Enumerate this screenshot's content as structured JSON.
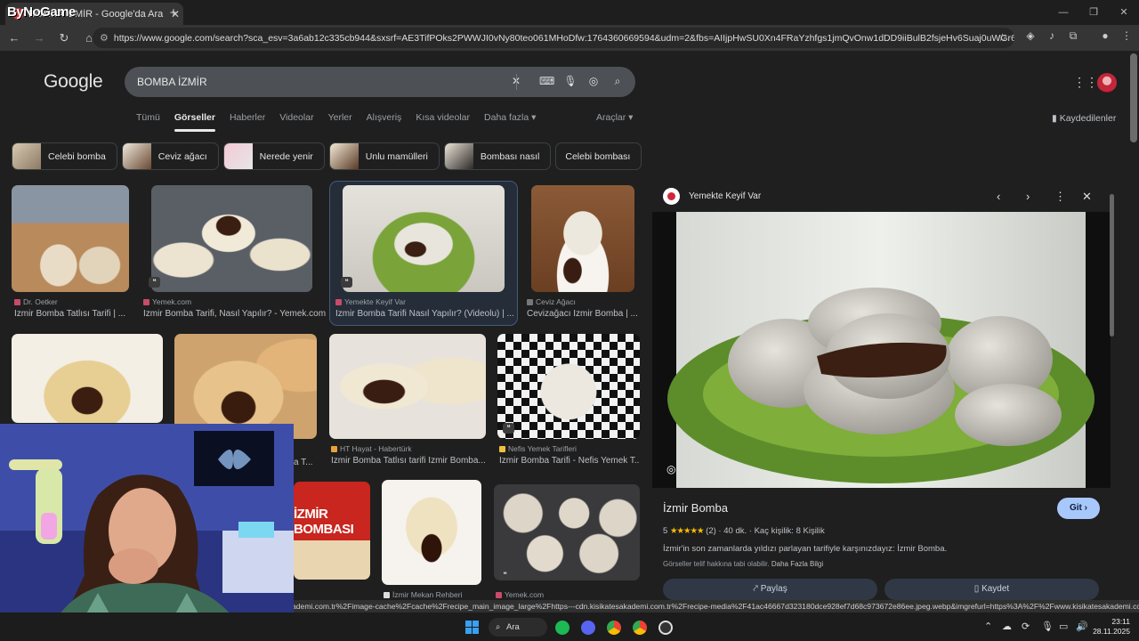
{
  "browser": {
    "tab_title": "BOMBA İZMİR - Google'da Ara",
    "watermark": "ByNoGame",
    "new_tab_icon": "plus-icon",
    "url": "https://www.google.com/search?sca_esv=3a6ab12c335cb944&sxsrf=AE3TifPOks2PWWJI0vNy80teo061MHoDfw:1764360669594&udm=2&fbs=AIIjpHwSU0Xn4FRaYzhfgs1jmQvOnw1dDD9iiBulB2fsjeHv6Suaj0uWGr65idqq_D8h15FYdr_s8g..."
  },
  "google": {
    "logo": "Google",
    "query": "BOMBA İZMİR",
    "tabs": [
      "Tümü",
      "Görseller",
      "Haberler",
      "Videolar",
      "Yerler",
      "Alışveriş",
      "Kısa videolar",
      "Daha fazla ▾"
    ],
    "active_tab": "Görseller",
    "tools": "Araçlar ▾",
    "saved": "Kaydedilenler"
  },
  "chips": [
    "Celebi bomba",
    "Ceviz ağacı",
    "Nerede yenir",
    "Unlu mamülleri",
    "Bombası nasıl",
    "Celebi bombası"
  ],
  "results": [
    {
      "source": "Dr. Oetker",
      "caption": "İzmir Bomba Tatlısı Tarifi | ..."
    },
    {
      "source": "Yemek.com",
      "caption": "İzmir Bomba Tarifi, Nasıl Yapılır? - Yemek.com"
    },
    {
      "source": "Yemekte Keyif Var",
      "caption": "İzmir Bomba Tarifi Nasıl Yapılır? (Videolu) | ..."
    },
    {
      "source": "Ceviz Ağacı",
      "caption": "Cevizağacı İzmir Bomba | ..."
    },
    {
      "source": "HT Hayat - Habertürk",
      "caption": "İzmir Bomba Tatlısı tarifi İzmir Bomba..."
    },
    {
      "source": "Nefis Yemek Tarifleri",
      "caption": "İzmir Bomba Tarifi - Nefis Yemek T..."
    },
    {
      "source": "İzmir Mekan Rehberi",
      "caption": ""
    },
    {
      "source": "Yemek.com",
      "caption": ""
    },
    {
      "partial_caption": "a T...",
      "image_text": "İZMİR BOMBASI"
    }
  ],
  "panel": {
    "site": "Yemekte Keyif Var",
    "title": "İzmir Bomba",
    "visit": "Git ›",
    "rating": "5",
    "stars": "★★★★★",
    "rating_count": "(2)",
    "time": "40 dk.",
    "servings": "Kaç kişilik: 8 Kişilik",
    "description": "İzmir'in son zamanlarda yıldızı parlayan tarifiyle karşınızdayız: İzmir Bomba.",
    "copyright": "Görseller telif hakkına tabi olabilir.",
    "more_info": "Daha Fazla Bilgi",
    "share": "Paylaş",
    "save": "Kaydet"
  },
  "status_url": "ademi.com.tr%2Fimage-cache%2Fcache%2Frecipe_main_image_large%2Fhttps---cdn.kisikatesakademi.com.tr%2Frecipe-media%2F41ac46667d323180dce928ef7d68c973672e86ee.jpeg.webp&imgrefurl=https%3A%2F%2Fwww.kisikatesakademi.com.tr%2Ftarif%...",
  "taskbar": {
    "search": "Ara",
    "time": "23:11",
    "date": "28.11.2025"
  },
  "colors": {
    "accent": "#a8c7fa",
    "background": "#1f1f1f",
    "search_box": "#4d5156"
  }
}
